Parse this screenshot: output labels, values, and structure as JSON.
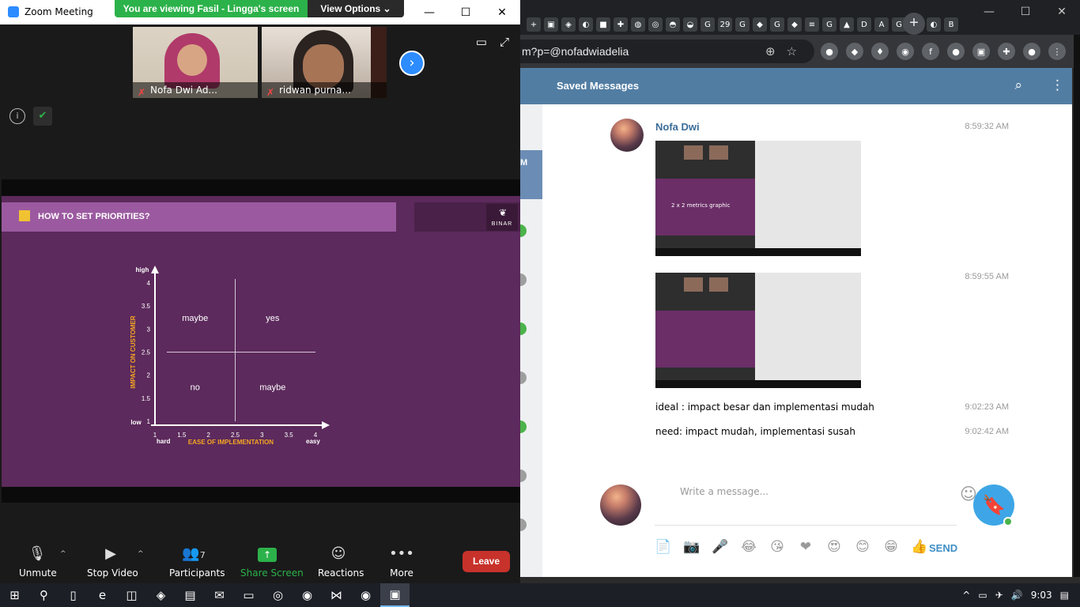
{
  "browser": {
    "tab_icons": [
      "+",
      "▣",
      "◈",
      "◐",
      "■",
      "✚",
      "◍",
      "◎",
      "◓",
      "◒",
      "G",
      "29",
      "G",
      "◆",
      "G",
      "◆",
      "≡",
      "G",
      "▲",
      "D",
      "A",
      "G",
      "G",
      "◐",
      "B"
    ],
    "new_tab": "+",
    "url_fragment": "m?p=@nofadwiadelia",
    "url_icons": [
      "⊕",
      "☆"
    ],
    "extension_icons": [
      "●",
      "◆",
      "♦",
      "◉",
      "f",
      "●",
      "▣",
      "✚",
      "●",
      "⋮"
    ],
    "win_controls": [
      "—",
      "☐",
      "✕"
    ]
  },
  "telegram": {
    "title": "Saved Messages",
    "search_icon": "⌕",
    "menu_icon": "⋮",
    "left_strip_initial": "M",
    "sender": "Nofa Dwi",
    "messages": [
      {
        "type": "image",
        "time": "8:59:32 AM",
        "caption": "2 x 2 metrics graphic"
      },
      {
        "type": "image",
        "time": "8:59:55 AM"
      },
      {
        "type": "text",
        "time": "9:02:23 AM",
        "text": "ideal : impact besar dan implementasi mudah"
      },
      {
        "type": "text",
        "time": "9:02:42 AM",
        "text": "need: impact mudah, implementasi susah"
      }
    ],
    "input_placeholder": "Write a message...",
    "emoji_icon": "☺",
    "bookmark_icon": "🔖",
    "tools": [
      "📄",
      "📷",
      "🎤",
      "😂",
      "😘",
      "❤",
      "😍",
      "😊",
      "😁",
      "👍"
    ],
    "send_label": "SEND"
  },
  "zoom": {
    "title": "Zoom Meeting",
    "banner": "You are viewing Fasil - Lingga's screen",
    "view_options": "View Options ⌄",
    "win_controls": [
      "—",
      "☐",
      "✕"
    ],
    "participants": [
      {
        "name": "Nofa Dwi Ad..."
      },
      {
        "name": "ridwan purna..."
      }
    ],
    "next_icon": "›",
    "top_icons": [
      "▭",
      "⤢"
    ],
    "info_icon": "i",
    "shield_icon": "✔",
    "toolbar": {
      "unmute": "Unmute",
      "stop_video": "Stop Video",
      "participants": "Participants",
      "participants_count": "7",
      "share_screen": "Share Screen",
      "reactions": "Reactions",
      "more": "More",
      "leave": "Leave",
      "caret": "^"
    }
  },
  "slide": {
    "title": "HOW TO SET PRIORITIES?",
    "logo_text": "BINAR",
    "logo_mark": "❦"
  },
  "chart_data": {
    "type": "scatter",
    "title": "",
    "xlabel": "EASE OF IMPLEMENTATION",
    "ylabel": "IMPACT ON CUSTOMER",
    "x_ticks": [
      "1",
      "1.5",
      "2",
      "2.5",
      "3",
      "3.5",
      "4"
    ],
    "y_ticks": [
      "1",
      "1.5",
      "2",
      "2.5",
      "3",
      "3.5",
      "4"
    ],
    "xlim": [
      1,
      4
    ],
    "ylim": [
      1,
      4
    ],
    "x_low_label": "hard",
    "x_high_label": "easy",
    "y_low_label": "low",
    "y_high_label": "high",
    "quadrants": [
      {
        "label": "maybe",
        "x": 1.75,
        "y": 3.25
      },
      {
        "label": "yes",
        "x": 3.2,
        "y": 3.25
      },
      {
        "label": "no",
        "x": 1.75,
        "y": 1.75
      },
      {
        "label": "maybe",
        "x": 3.2,
        "y": 1.75
      }
    ],
    "divider_x": 2.5,
    "divider_y": 2.5,
    "colors": {
      "axis": "#ffffff",
      "label": "#f5a623",
      "divider": "#d8c8d8"
    }
  },
  "taskbar": {
    "apps": [
      "⊞",
      "⚲",
      "▯",
      "e",
      "◫",
      "◈",
      "▤",
      "✉",
      "▭",
      "◎",
      "◉",
      "⋈",
      "◉",
      "▣"
    ],
    "tray": [
      "^",
      "▭",
      "✈",
      "🔊",
      "9:03",
      "▤"
    ]
  }
}
